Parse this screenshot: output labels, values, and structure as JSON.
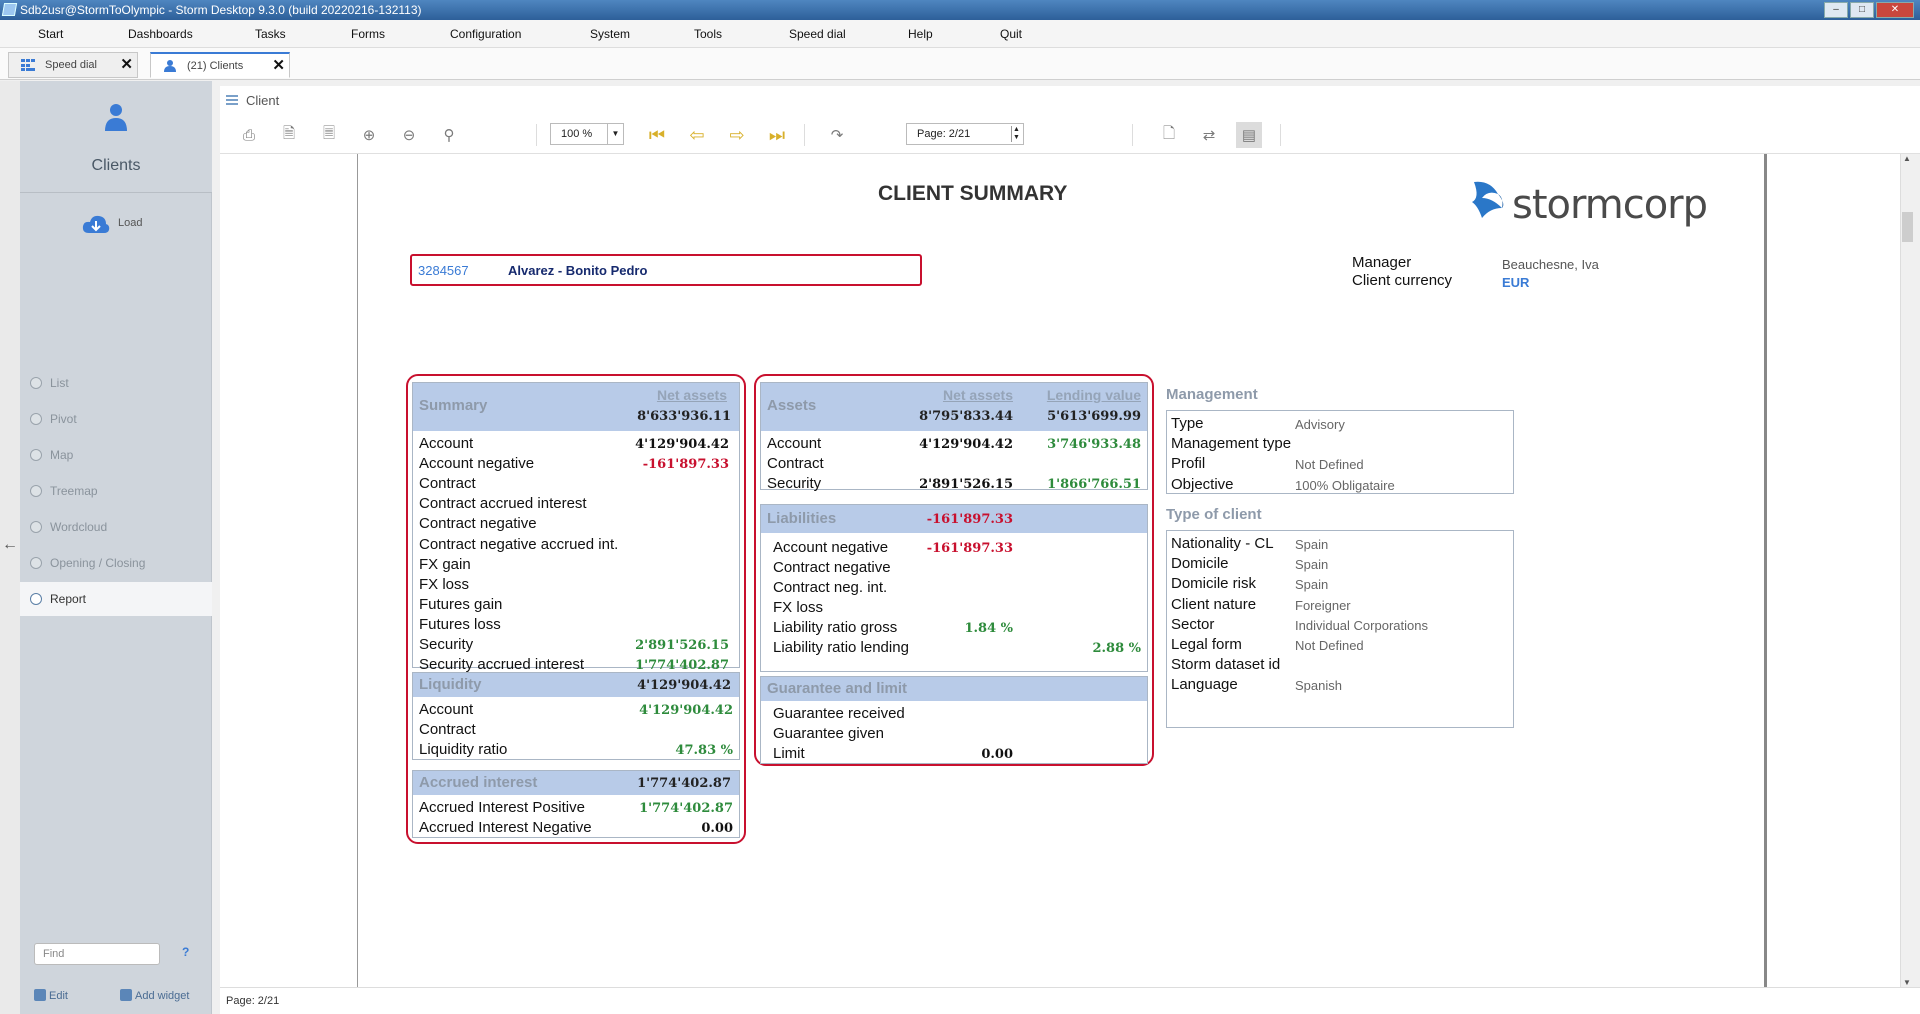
{
  "window": {
    "title": "Sdb2usr@StormToOlympic -  Storm Desktop 9.3.0 (build 20220216-132113)"
  },
  "menu": [
    "Start",
    "Dashboards",
    "Tasks",
    "Forms",
    "Configuration",
    "System",
    "Tools",
    "Speed dial",
    "Help",
    "Quit"
  ],
  "tabs": [
    {
      "label": "Speed dial"
    },
    {
      "label": "(21) Clients"
    }
  ],
  "sidebar": {
    "title": "Clients",
    "load": "Load",
    "items": [
      "List",
      "Pivot",
      "Map",
      "Treemap",
      "Wordcloud",
      "Opening / Closing",
      "Report"
    ],
    "active": "Report",
    "find_placeholder": "Find",
    "help": "?",
    "edit": "Edit",
    "add_widget": "Add widget"
  },
  "breadcrumb": "Client",
  "toolbar": {
    "zoom": "100 %",
    "page": "Page: 2/21"
  },
  "status": "Page: 2/21",
  "report": {
    "title": "CLIENT SUMMARY",
    "logo_text": "stormcorp",
    "client_id": "3284567",
    "client_name": "Alvarez - Bonito Pedro",
    "manager_label": "Manager",
    "manager_value": "Beauchesne, Iva",
    "currency_label": "Client currency",
    "currency_value": "EUR",
    "summary": {
      "title": "Summary",
      "col": "Net assets",
      "total": "8'633'936.11",
      "rows": [
        {
          "label": "Account",
          "value": "4'129'904.42",
          "color": "black"
        },
        {
          "label": "Account negative",
          "value": "-161'897.33",
          "color": "red"
        },
        {
          "label": "Contract",
          "value": "",
          "color": "black"
        },
        {
          "label": "Contract accrued interest",
          "value": "",
          "color": "black"
        },
        {
          "label": "Contract negative",
          "value": "",
          "color": "black"
        },
        {
          "label": "Contract negative accrued int.",
          "value": "",
          "color": "black"
        },
        {
          "label": "FX gain",
          "value": "",
          "color": "black"
        },
        {
          "label": "FX loss",
          "value": "",
          "color": "black"
        },
        {
          "label": "Futures gain",
          "value": "",
          "color": "black"
        },
        {
          "label": "Futures loss",
          "value": "",
          "color": "black"
        },
        {
          "label": "Security",
          "value": "2'891'526.15",
          "color": "green"
        },
        {
          "label": "Security accrued interest",
          "value": "1'774'402.87",
          "color": "green"
        }
      ]
    },
    "liquidity": {
      "title": "Liquidity",
      "total": "4'129'904.42",
      "rows": [
        {
          "label": "Account",
          "value": "4'129'904.42",
          "color": "green"
        },
        {
          "label": "Contract",
          "value": "",
          "color": "black"
        },
        {
          "label": "Liquidity ratio",
          "value": "47.83 %",
          "color": "green"
        }
      ]
    },
    "accrued": {
      "title": "Accrued interest",
      "total": "1'774'402.87",
      "rows": [
        {
          "label": "Accrued Interest Positive",
          "value": "1'774'402.87",
          "color": "green"
        },
        {
          "label": "Accrued Interest Negative",
          "value": "0.00",
          "color": "black"
        }
      ]
    },
    "assets": {
      "title": "Assets",
      "col1": "Net assets",
      "col2": "Lending value",
      "total1": "8'795'833.44",
      "total2": "5'613'699.99",
      "rows": [
        {
          "label": "Account",
          "v1": "4'129'904.42",
          "v2": "3'746'933.48"
        },
        {
          "label": "Contract",
          "v1": "",
          "v2": ""
        },
        {
          "label": "Security",
          "v1": "2'891'526.15",
          "v2": "1'866'766.51"
        }
      ]
    },
    "liabilities": {
      "title": "Liabilities",
      "total": "-161'897.33",
      "rows": [
        {
          "label": "Account negative",
          "v1": "-161'897.33",
          "v2": "",
          "c1": "red"
        },
        {
          "label": "Contract negative",
          "v1": "",
          "v2": "",
          "c1": "black"
        },
        {
          "label": "Contract neg. int.",
          "v1": "",
          "v2": "",
          "c1": "black"
        },
        {
          "label": "FX loss",
          "v1": "",
          "v2": "",
          "c1": "black"
        },
        {
          "label": "Liability ratio gross",
          "v1": "1.84 %",
          "v2": "",
          "c1": "green"
        },
        {
          "label": "Liability ratio lending",
          "v1": "",
          "v2": "2.88 %",
          "c1": "green"
        }
      ]
    },
    "guarantee": {
      "title": "Guarantee and limit",
      "rows": [
        {
          "label": "Guarantee received",
          "v1": ""
        },
        {
          "label": "Guarantee given",
          "v1": ""
        },
        {
          "label": "Limit",
          "v1": "0.00"
        }
      ]
    },
    "management": {
      "title": "Management",
      "rows": [
        {
          "key": "Type",
          "value": "Advisory"
        },
        {
          "key": "Management type",
          "value": ""
        },
        {
          "key": "Profil",
          "value": "Not Defined"
        },
        {
          "key": "Objective",
          "value": "100% Obligataire"
        }
      ]
    },
    "client_type": {
      "title": "Type of client",
      "rows": [
        {
          "key": "Nationality - CL",
          "value": "Spain"
        },
        {
          "key": "Domicile",
          "value": "Spain"
        },
        {
          "key": "Domicile risk",
          "value": "Spain"
        },
        {
          "key": "Client nature",
          "value": "Foreigner"
        },
        {
          "key": "Sector",
          "value": "Individual Corporations"
        },
        {
          "key": "Legal form",
          "value": "Not Defined"
        },
        {
          "key": "Storm dataset id",
          "value": ""
        },
        {
          "key": "Language",
          "value": "Spanish"
        }
      ]
    }
  },
  "colors": {
    "accent": "#3a7bd5",
    "redbox": "#c8102e",
    "header_bg": "#b8cbe8",
    "green": "#2e8b3c",
    "red": "#c8102e"
  }
}
